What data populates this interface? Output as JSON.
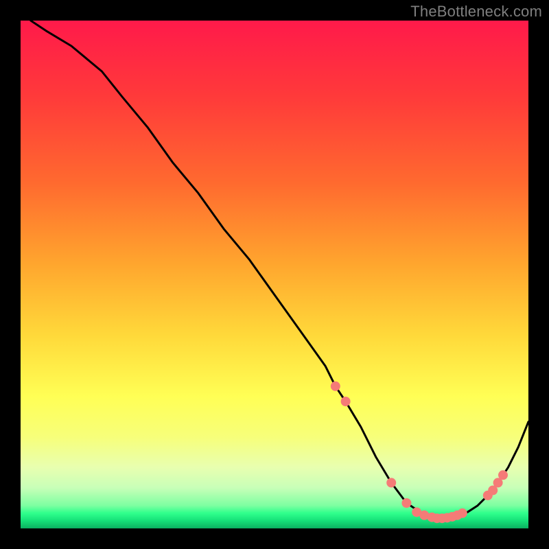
{
  "watermark": "TheBottleneck.com",
  "chart_data": {
    "type": "line",
    "title": "",
    "xlabel": "",
    "ylabel": "",
    "xlim": [
      0,
      100
    ],
    "ylim": [
      0,
      100
    ],
    "curve": {
      "name": "curve",
      "x": [
        2,
        5,
        10,
        16,
        20,
        25,
        30,
        35,
        40,
        45,
        50,
        55,
        60,
        62,
        64,
        67,
        70,
        73,
        76,
        79,
        82,
        84,
        86,
        88,
        90,
        92,
        94,
        96,
        98,
        100
      ],
      "y": [
        100,
        98,
        95,
        90,
        85,
        79,
        72,
        66,
        59,
        53,
        46,
        39,
        32,
        28,
        25,
        20,
        14,
        9,
        5,
        3,
        2,
        2,
        2.5,
        3.2,
        4.5,
        6.5,
        9,
        12,
        16,
        21
      ]
    },
    "markers": {
      "name": "markers",
      "color": "#f57b77",
      "points": [
        {
          "x": 62,
          "y": 28
        },
        {
          "x": 64,
          "y": 25
        },
        {
          "x": 73,
          "y": 9
        },
        {
          "x": 76,
          "y": 5
        },
        {
          "x": 78,
          "y": 3.2
        },
        {
          "x": 79.5,
          "y": 2.6
        },
        {
          "x": 81,
          "y": 2.2
        },
        {
          "x": 82,
          "y": 2
        },
        {
          "x": 83,
          "y": 2
        },
        {
          "x": 84,
          "y": 2.1
        },
        {
          "x": 85,
          "y": 2.3
        },
        {
          "x": 86,
          "y": 2.6
        },
        {
          "x": 87,
          "y": 3
        },
        {
          "x": 92,
          "y": 6.5
        },
        {
          "x": 93,
          "y": 7.5
        },
        {
          "x": 94,
          "y": 9
        },
        {
          "x": 95,
          "y": 10.5
        }
      ]
    },
    "gradient_stops": [
      {
        "offset": 0,
        "color": "#ff1a4a"
      },
      {
        "offset": 0.15,
        "color": "#ff3a3a"
      },
      {
        "offset": 0.32,
        "color": "#ff6a2f"
      },
      {
        "offset": 0.48,
        "color": "#ffa62e"
      },
      {
        "offset": 0.62,
        "color": "#ffd93a"
      },
      {
        "offset": 0.74,
        "color": "#ffff55"
      },
      {
        "offset": 0.82,
        "color": "#f7ff7a"
      },
      {
        "offset": 0.88,
        "color": "#e8ffb0"
      },
      {
        "offset": 0.92,
        "color": "#c8ffb8"
      },
      {
        "offset": 0.955,
        "color": "#7dffa1"
      },
      {
        "offset": 0.97,
        "color": "#2fff8c"
      },
      {
        "offset": 0.985,
        "color": "#15e078"
      },
      {
        "offset": 1.0,
        "color": "#0bb060"
      }
    ]
  }
}
